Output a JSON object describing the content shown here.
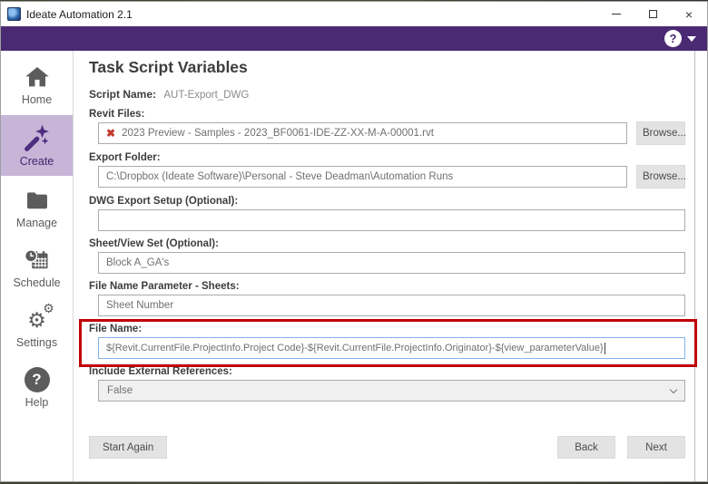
{
  "window": {
    "title": "Ideate Automation 2.1",
    "controls": {
      "minimize": "–",
      "maximize": "□",
      "close": "×"
    }
  },
  "appbar": {
    "help_icon": "?",
    "accent_color": "#4B2A74"
  },
  "sidebar": {
    "selected_bg": "#C7B5D8",
    "selected_color": "#4F2D7F",
    "items": [
      {
        "label": "Home",
        "icon": "home-icon",
        "selected": false
      },
      {
        "label": "Create",
        "icon": "magic-wand-icon",
        "selected": true
      },
      {
        "label": "Manage",
        "icon": "folder-icon",
        "selected": false
      },
      {
        "label": "Schedule",
        "icon": "calendar-clock-icon",
        "selected": false
      },
      {
        "label": "Settings",
        "icon": "gears-icon",
        "selected": false
      },
      {
        "label": "Help",
        "icon": "help-circle-icon",
        "selected": false
      }
    ]
  },
  "main": {
    "title": "Task Script Variables",
    "script_name": {
      "label": "Script Name:",
      "value": "AUT-Export_DWG"
    },
    "fields": {
      "revit_files": {
        "label": "Revit Files:",
        "value": "2023 Preview - Samples - 2023_BF0061-IDE-ZZ-XX-M-A-00001.rvt",
        "status_icon": "✖",
        "status_color": "#C0392B",
        "browse_label": "Browse..."
      },
      "export_folder": {
        "label": "Export Folder:",
        "value": "C:\\Dropbox (Ideate Software)\\Personal - Steve Deadman\\Automation Runs",
        "browse_label": "Browse..."
      },
      "dwg_export_setup": {
        "label": "DWG Export Setup (Optional):",
        "value": ""
      },
      "sheet_view_set": {
        "label": "Sheet/View Set (Optional):",
        "value": "Block A_GA's"
      },
      "file_name_parameter": {
        "label": "File Name Parameter - Sheets:",
        "value": "Sheet Number"
      },
      "file_name": {
        "label": "File Name:",
        "value": "${Revit.CurrentFile.ProjectInfo.Project Code}-${Revit.CurrentFile.ProjectInfo.Originator}-${view_parameterValue}",
        "focused": true,
        "focus_border_color": "#7EB4EA",
        "annotation_color": "#C00000"
      },
      "include_external_references": {
        "label": "Include External References:",
        "value": "False"
      }
    },
    "buttons": {
      "start_again": "Start Again",
      "back": "Back",
      "next": "Next"
    }
  }
}
